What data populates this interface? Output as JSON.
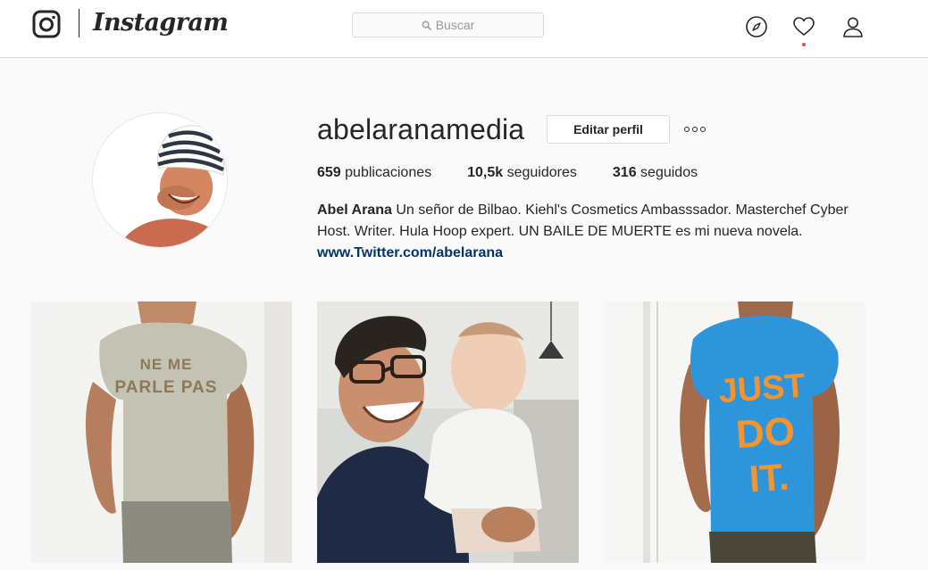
{
  "nav": {
    "brand": "Instagram",
    "search_placeholder": "Buscar",
    "icons": [
      "instagram-glyph-icon",
      "search-icon",
      "compass-icon",
      "heart-icon",
      "user-icon"
    ],
    "notification_dot_color": "#ed4956"
  },
  "profile": {
    "username": "abelaranamedia",
    "edit_button": "Editar perfil",
    "stats": [
      {
        "count": "659",
        "label": "publicaciones"
      },
      {
        "count": "10,5k",
        "label": "seguidores"
      },
      {
        "count": "316",
        "label": "seguidos"
      }
    ],
    "bio": {
      "name": "Abel Arana",
      "text": "Un señor de Bilbao. Kiehl's Cosmetics Ambasssador. Masterchef Cyber Host. Writer. Hula Hoop expert. UN BAILE DE MUERTE es mi nueva novela.",
      "link": "www.Twitter.com/abelarana"
    }
  },
  "posts": [
    {
      "shirt_text_1": "NE ME",
      "shirt_text_2": "PARLE PAS"
    },
    {
      "shirt_text_1": "",
      "shirt_text_2": ""
    },
    {
      "shirt_text_1": "JUST",
      "shirt_text_2": "DO",
      "shirt_text_3": "IT."
    }
  ],
  "colors": {
    "background": "#fafafa",
    "text": "#262626",
    "link": "#003569",
    "border": "#dbdbdb"
  }
}
